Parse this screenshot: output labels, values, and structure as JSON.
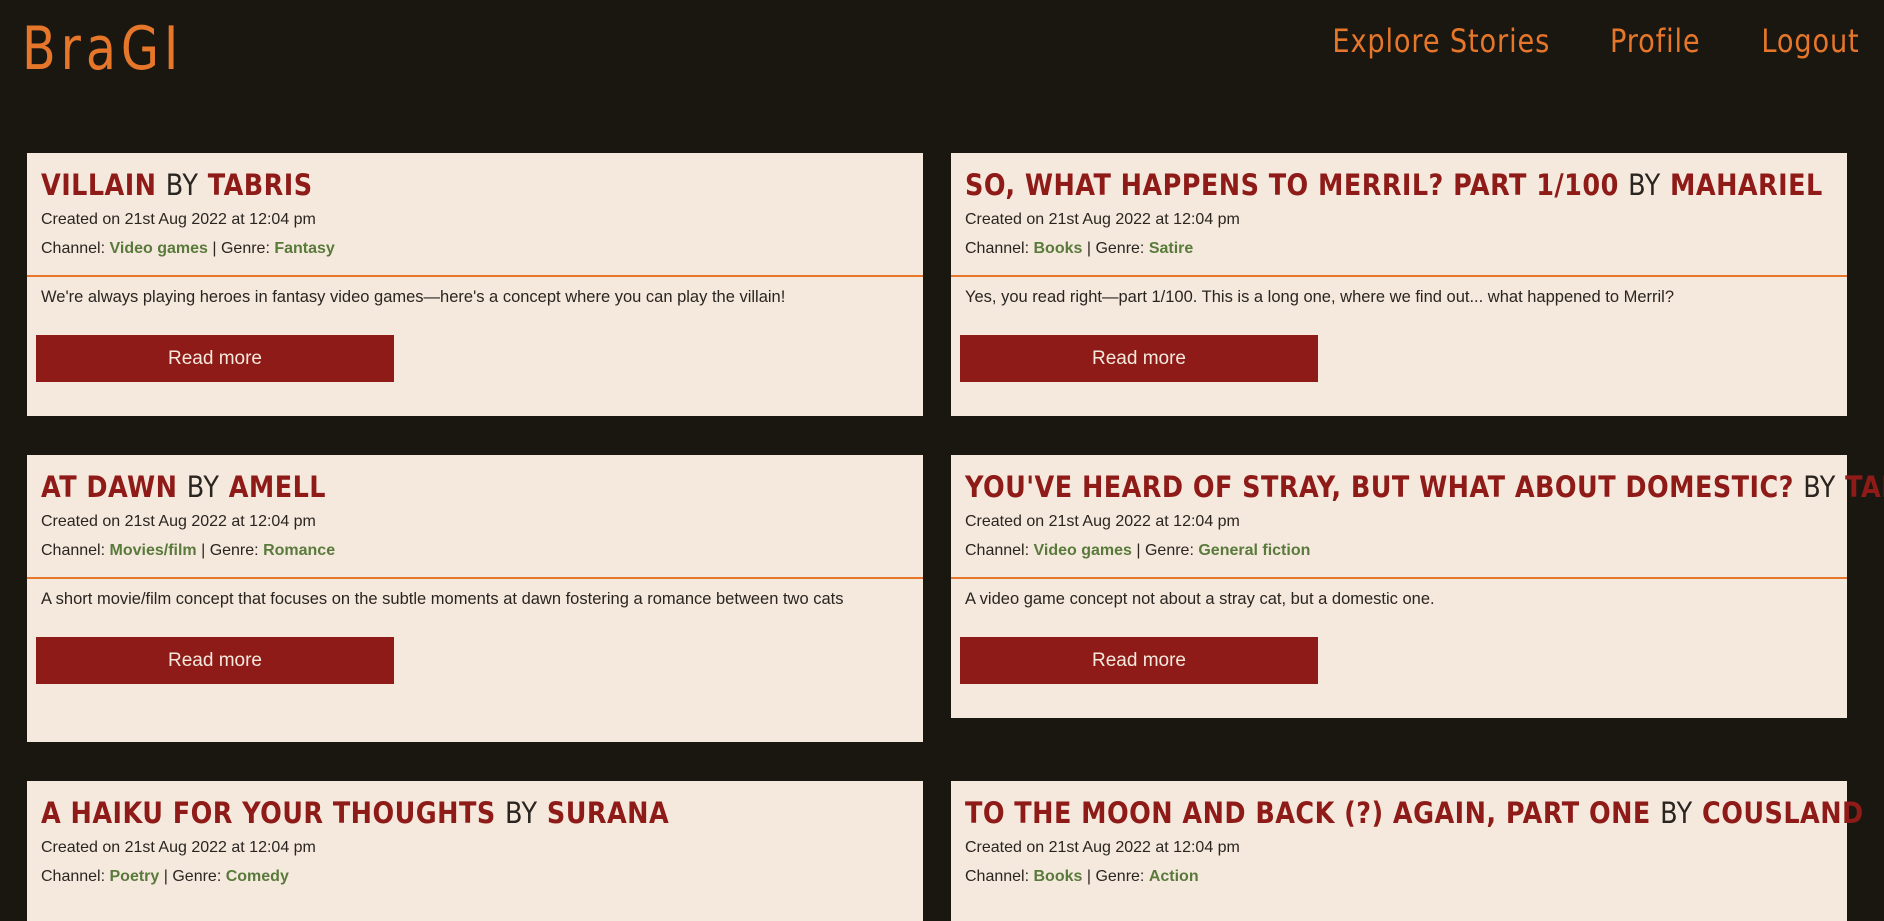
{
  "nav": {
    "logo": "BraGI",
    "links": [
      "Explore Stories",
      "Profile",
      "Logout"
    ]
  },
  "labels": {
    "created_prefix": "Created on",
    "channel_prefix": "Channel:",
    "genre_prefix": "Genre:",
    "by": "BY",
    "read_more": "Read more"
  },
  "stories": [
    {
      "title": "VILLAIN",
      "author": "TABRIS",
      "created": "21st Aug 2022 at 12:04 pm",
      "channel": "Video games",
      "genre": "Fantasy",
      "description": "We're always playing heroes in fantasy video games—here's a concept where you can play the villain!"
    },
    {
      "title": "SO, WHAT HAPPENS TO MERRIL? PART 1/100",
      "author": "MAHARIEL",
      "created": "21st Aug 2022 at 12:04 pm",
      "channel": "Books",
      "genre": "Satire",
      "description": "Yes, you read right—part 1/100. This is a long one, where we find out... what happened to Merril?"
    },
    {
      "title": "AT DAWN",
      "author": "AMELL",
      "created": "21st Aug 2022 at 12:04 pm",
      "channel": "Movies/film",
      "genre": "Romance",
      "description": "A short movie/film concept that focuses on the subtle moments at dawn fostering a romance between two cats"
    },
    {
      "title": "YOU'VE HEARD OF STRAY, BUT WHAT ABOUT DOMESTIC?",
      "author": "TABRIS",
      "created": "21st Aug 2022 at 12:04 pm",
      "channel": "Video games",
      "genre": "General fiction",
      "description": "A video game concept not about a stray cat, but a domestic one."
    },
    {
      "title": "A HAIKU FOR YOUR THOUGHTS",
      "author": "SURANA",
      "created": "21st Aug 2022 at 12:04 pm",
      "channel": "Poetry",
      "genre": "Comedy",
      "description": ""
    },
    {
      "title": "TO THE MOON AND BACK (?) AGAIN, PART ONE",
      "author": "COUSLAND",
      "created": "21st Aug 2022 at 12:04 pm",
      "channel": "Books",
      "genre": "Action",
      "description": ""
    }
  ]
}
